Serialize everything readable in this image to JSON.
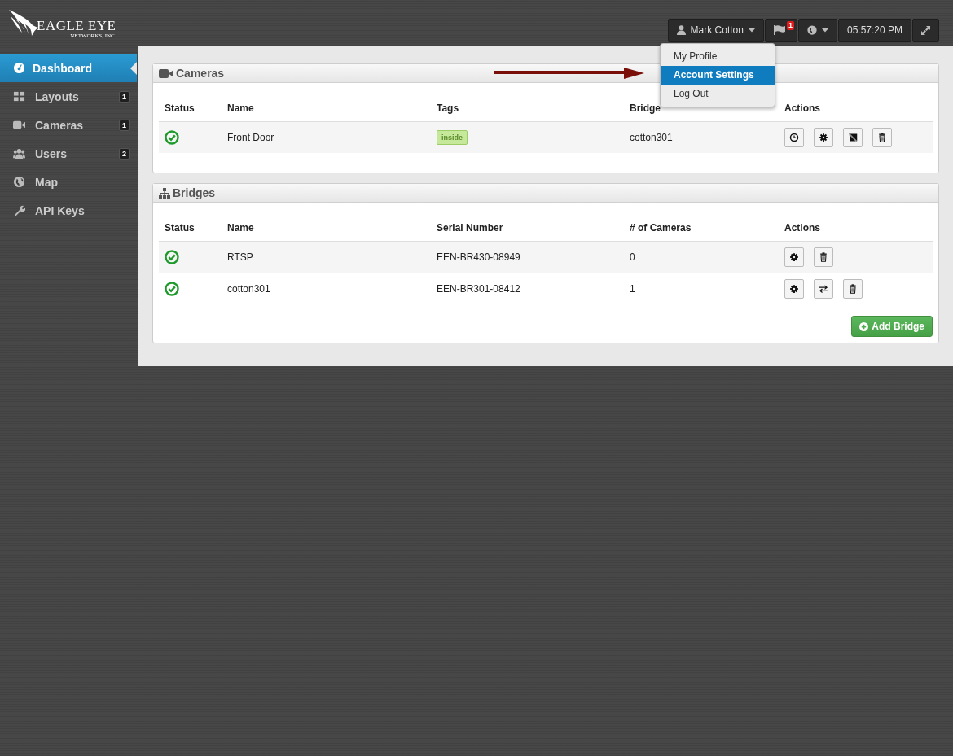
{
  "logo": {
    "title": "EAGLE EYE",
    "subtitle": "NETWORKS, INC."
  },
  "topbar": {
    "user": "Mark Cotton",
    "alerts_count": "1",
    "time": "05:57:20 PM"
  },
  "user_menu": [
    {
      "label": "My Profile",
      "selected": false
    },
    {
      "label": "Account Settings",
      "selected": true
    },
    {
      "label": "Log Out",
      "selected": false
    }
  ],
  "sidebar": {
    "items": [
      {
        "label": "Dashboard",
        "selected": true
      },
      {
        "label": "Layouts",
        "count": "1",
        "selected": false
      },
      {
        "label": "Cameras",
        "count": "1",
        "selected": false
      },
      {
        "label": "Users",
        "count": "2",
        "selected": false
      },
      {
        "label": "Map",
        "selected": false
      },
      {
        "label": "API Keys",
        "selected": false
      }
    ]
  },
  "cameras": {
    "title": "Cameras",
    "columns": [
      "Status",
      "Name",
      "Tags",
      "Bridge",
      "Actions"
    ],
    "rows": [
      {
        "online": true,
        "name": "Front Door",
        "tags": [
          "inside"
        ],
        "bridge": "cotton301",
        "actions": [
          {
            "kind": "history"
          },
          {
            "kind": "settings"
          },
          {
            "kind": "preview"
          },
          {
            "kind": "delete"
          }
        ]
      }
    ]
  },
  "bridges": {
    "title": "Bridges",
    "columns": [
      "Status",
      "Name",
      "Serial Number",
      "# of Cameras",
      "Actions"
    ],
    "rows": [
      {
        "online": true,
        "name": "RTSP",
        "serial": "EEN-BR430-08949",
        "cameras": "0",
        "actions": [
          {
            "kind": "settings"
          },
          {
            "kind": "delete"
          }
        ]
      },
      {
        "online": true,
        "name": "cotton301",
        "serial": "EEN-BR301-08412",
        "cameras": "1",
        "actions": [
          {
            "kind": "settings"
          },
          {
            "kind": "swap"
          },
          {
            "kind": "delete"
          }
        ]
      }
    ],
    "add_button": "Add Bridge"
  }
}
